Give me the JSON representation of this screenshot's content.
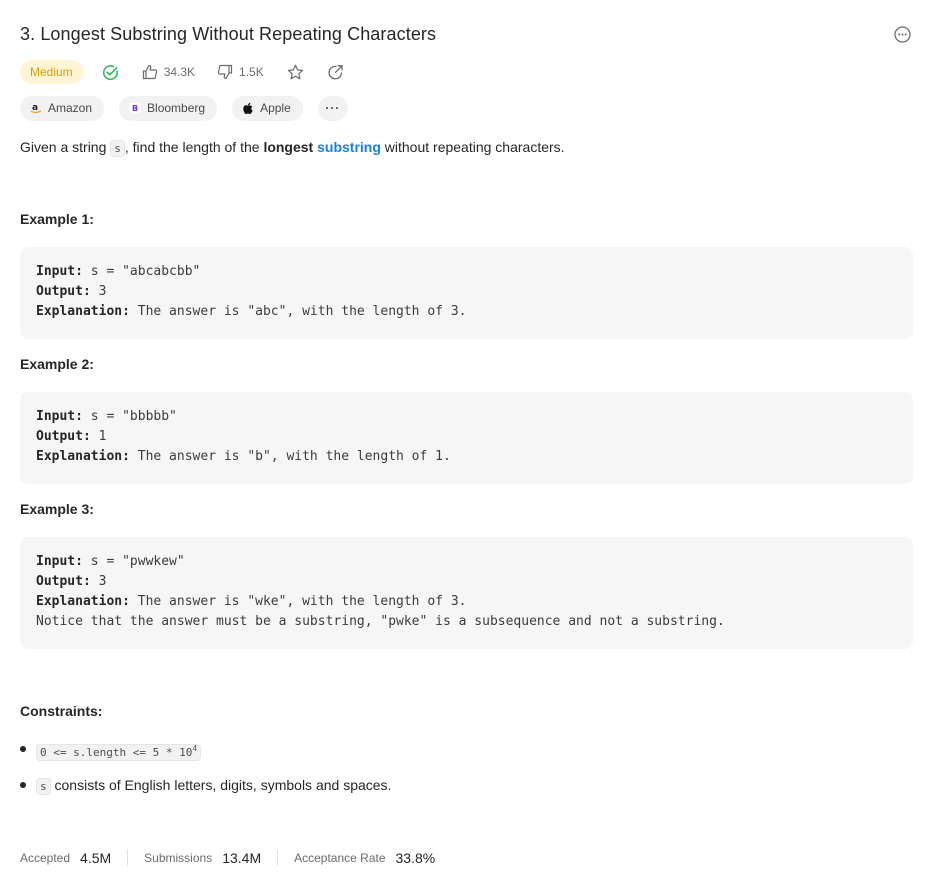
{
  "problem": {
    "title": "3. Longest Substring Without Repeating Characters",
    "difficulty": "Medium",
    "likes": "34.3K",
    "dislikes": "1.5K"
  },
  "tags": [
    {
      "label": "Amazon",
      "icon": "amazon-icon"
    },
    {
      "label": "Bloomberg",
      "icon": "bloomberg-icon"
    },
    {
      "label": "Apple",
      "icon": "apple-icon"
    },
    {
      "label": "···",
      "icon": "more-icon"
    }
  ],
  "description": {
    "before": "Given a string ",
    "code": "s",
    "middle": ", find the length of the ",
    "bold": "longest",
    "link": "substring",
    "after": " without repeating characters."
  },
  "examples": [
    {
      "title": "Example 1:",
      "input_key": "Input:",
      "input": " s = \"abcabcbb\"",
      "output_key": "Output:",
      "output": " 3",
      "explanation_key": "Explanation:",
      "explanation": " The answer is \"abc\", with the length of 3.",
      "note": ""
    },
    {
      "title": "Example 2:",
      "input_key": "Input:",
      "input": " s = \"bbbbb\"",
      "output_key": "Output:",
      "output": " 1",
      "explanation_key": "Explanation:",
      "explanation": " The answer is \"b\", with the length of 1.",
      "note": ""
    },
    {
      "title": "Example 3:",
      "input_key": "Input:",
      "input": " s = \"pwwkew\"",
      "output_key": "Output:",
      "output": " 3",
      "explanation_key": "Explanation:",
      "explanation": " The answer is \"wke\", with the length of 3.",
      "note": "Notice that the answer must be a substring, \"pwke\" is a subsequence and not a substring."
    }
  ],
  "constraints": {
    "title": "Constraints:",
    "c1": "0 <= s.length <= 5 * 10",
    "c1_exp": "4",
    "c2_code": "s",
    "c2_text": " consists of English letters, digits, symbols and spaces."
  },
  "stats": {
    "accepted_label": "Accepted",
    "accepted": "4.5M",
    "submissions_label": "Submissions",
    "submissions": "13.4M",
    "rate_label": "Acceptance Rate",
    "rate": "33.8%"
  },
  "colors": {
    "difficulty_bg": "#fff4d4",
    "difficulty_text": "#d4a000",
    "solved_green": "#2cbb5d",
    "link_blue": "#1a7fe0"
  }
}
